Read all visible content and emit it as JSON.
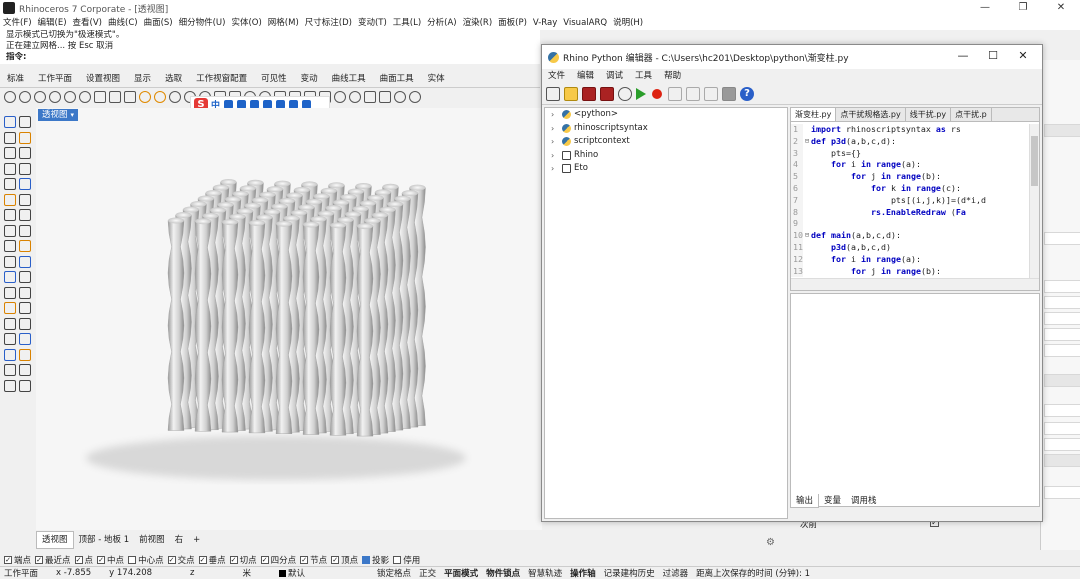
{
  "window": {
    "title": "Rhinoceros 7 Corporate - [透视图]"
  },
  "menubar": [
    "文件(F)",
    "编辑(E)",
    "查看(V)",
    "曲线(C)",
    "曲面(S)",
    "细分物件(U)",
    "实体(O)",
    "网格(M)",
    "尺寸标注(D)",
    "变动(T)",
    "工具(L)",
    "分析(A)",
    "渲染(R)",
    "面板(P)",
    "V-Ray",
    "VisualARQ",
    "说明(H)"
  ],
  "command": {
    "history_line_1": "显示模式已切换为\"极速模式\"。",
    "history_line_2": "正在建立网格... 按 Esc 取消",
    "prompt": "指令:"
  },
  "toolbar_tabs": [
    "标准",
    "工作平面",
    "设置视图",
    "显示",
    "选取",
    "工作视窗配置",
    "可见性",
    "变动",
    "曲线工具",
    "曲面工具",
    "实体"
  ],
  "ime": {
    "logo": "S",
    "mode": "中"
  },
  "viewport": {
    "label": "透视图",
    "dropdown": "▾"
  },
  "viewport_tabs": [
    "透视图",
    "顶部 - 地板 1",
    "前视图",
    "右",
    "+"
  ],
  "properties": {
    "back_label": "次前",
    "back_checked": "✓"
  },
  "osnap": [
    {
      "label": "端点",
      "checked": true
    },
    {
      "label": "最近点",
      "checked": true
    },
    {
      "label": "点",
      "checked": true
    },
    {
      "label": "中点",
      "checked": true
    },
    {
      "label": "中心点",
      "checked": false
    },
    {
      "label": "交点",
      "checked": true
    },
    {
      "label": "垂点",
      "checked": true
    },
    {
      "label": "切点",
      "checked": true
    },
    {
      "label": "四分点",
      "checked": true
    },
    {
      "label": "节点",
      "checked": true
    },
    {
      "label": "顶点",
      "checked": true
    },
    {
      "label": "投影",
      "checked": "blue"
    },
    {
      "label": "停用",
      "checked": false
    }
  ],
  "status": {
    "cplane": "工作平面",
    "x": "x -7.855",
    "y": "y 174.208",
    "z": "z",
    "units": "米",
    "layer": "默认",
    "grid_snap": "锁定格点",
    "ortho": "正交",
    "planar": "平面模式",
    "osnap": "物件锁点",
    "smarttrack": "智慧轨迹",
    "gumball": "操作轴",
    "history": "记录建构历史",
    "filter": "过滤器",
    "autosave": "距离上次保存的时间 (分钟): 1"
  },
  "python_editor": {
    "title": "Rhino Python 编辑器 - C:\\Users\\hc201\\Desktop\\python\\渐变柱.py",
    "menu": [
      "文件",
      "编辑",
      "调试",
      "工具",
      "帮助"
    ],
    "tree": [
      {
        "label": "<python>",
        "icon": "python"
      },
      {
        "label": "rhinoscriptsyntax",
        "icon": "python"
      },
      {
        "label": "scriptcontext",
        "icon": "python"
      },
      {
        "label": "Rhino",
        "icon": "box"
      },
      {
        "label": "Eto",
        "icon": "box"
      }
    ],
    "tabs": [
      "渐变柱.py",
      "点干扰规格选.py",
      "线干扰.py",
      "点干扰.p"
    ],
    "code": [
      {
        "n": "1",
        "fold": "",
        "text": "import rhinoscriptsyntax as rs"
      },
      {
        "n": "2",
        "fold": "⊟",
        "text": "def p3d(a,b,c,d):"
      },
      {
        "n": "3",
        "fold": "",
        "text": "    pts={}"
      },
      {
        "n": "4",
        "fold": "",
        "text": "    for i in range(a):"
      },
      {
        "n": "5",
        "fold": "",
        "text": "        for j in range(b):"
      },
      {
        "n": "6",
        "fold": "",
        "text": "            for k in range(c):"
      },
      {
        "n": "7",
        "fold": "",
        "text": "                pts[(i,j,k)]=(d*i,d"
      },
      {
        "n": "8",
        "fold": "",
        "text": "            rs.EnableRedraw (Fa"
      },
      {
        "n": "9",
        "fold": "",
        "text": ""
      },
      {
        "n": "10",
        "fold": "⊟",
        "text": "def main(a,b,c,d):"
      },
      {
        "n": "11",
        "fold": "",
        "text": "    p3d(a,b,c,d)"
      },
      {
        "n": "12",
        "fold": "",
        "text": "    for i in range(a):"
      },
      {
        "n": "13",
        "fold": "",
        "text": "        for j in range(b):"
      }
    ],
    "output_tabs": [
      "输出",
      "变量",
      "调用栈"
    ]
  }
}
